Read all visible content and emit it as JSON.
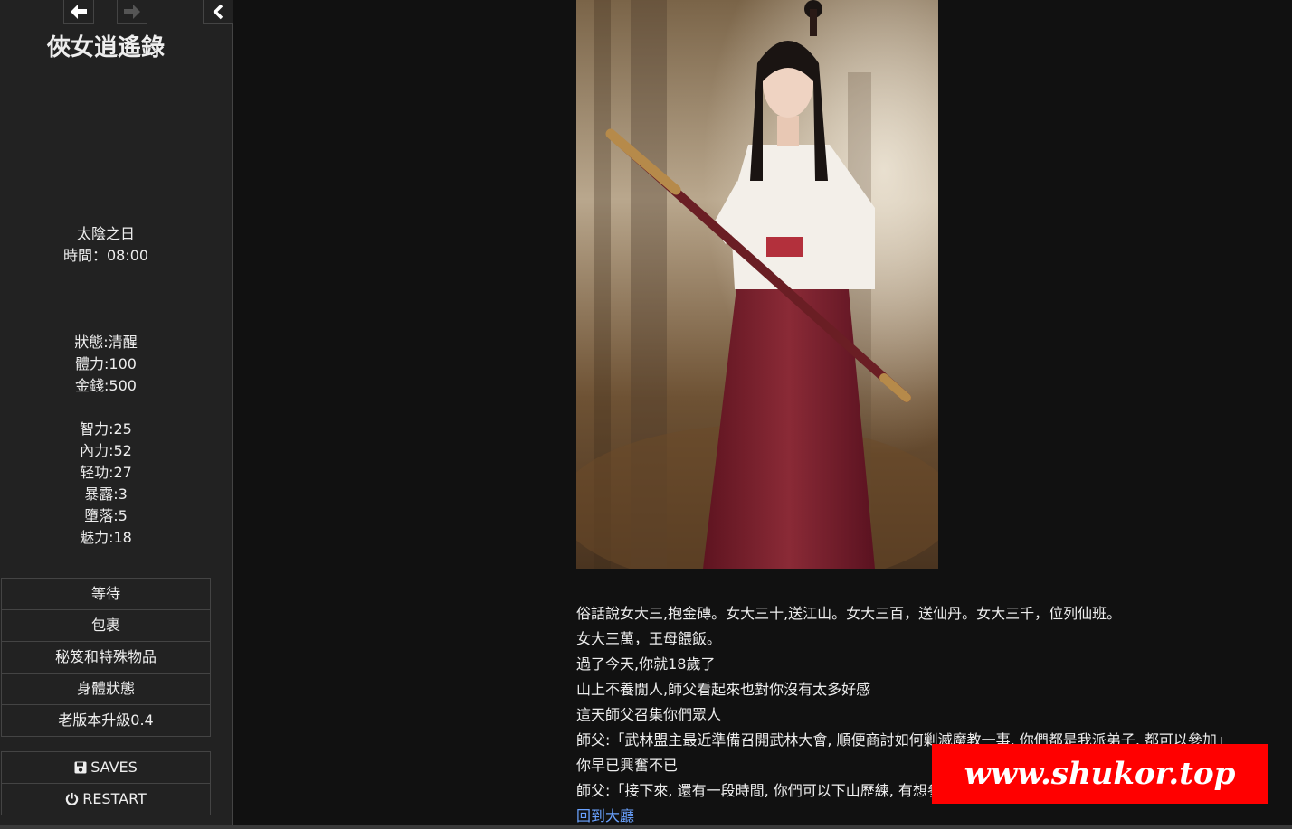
{
  "sidebar": {
    "title": "俠女逍遙錄",
    "day": "太陰之日",
    "time": "時間：08:00",
    "status": "狀態:清醒",
    "stamina": "體力:100",
    "money": "金錢:500",
    "intelligence": "智力:25",
    "inner_power": "內力:52",
    "lightness": "轻功:27",
    "exposure": "暴露:3",
    "depravity": "墮落:5",
    "charm": "魅力:18",
    "menu": [
      "等待",
      "包裹",
      "秘笈和特殊物品",
      "身體狀態",
      "老版本升級0.4"
    ],
    "saves_label": "SAVES",
    "restart_label": "RESTART"
  },
  "passage": {
    "lines": [
      "俗話說女大三,抱金磚。女大三十,送江山。女大三百，送仙丹。女大三千，位列仙班。",
      "女大三萬，王母餵飯。",
      "過了今天,你就18歲了",
      "山上不養閒人,師父看起來也對你沒有太多好感",
      "這天師父召集你們眾人",
      "師父:「武林盟主最近準備召開武林大會, 順便商討如何剿滅魔教一事, 你們都是我派弟子, 都可以參加」",
      "你早已興奮不已",
      "師父:「接下來, 還有一段時間, 你們可以下山歷練, 有想參加的, 明日隨我出發」"
    ],
    "return_link": "回到大廳"
  },
  "watermark": "www.shukor.top",
  "colors": {
    "sidebar_bg": "#222222",
    "page_bg": "#111111",
    "link": "#6aa2ff",
    "watermark_bg": "#ff0000"
  },
  "icons": {
    "back": "arrow-left-icon",
    "forward": "arrow-right-icon",
    "toggle": "chevron-left-icon",
    "saves": "floppy-disk-icon",
    "restart": "power-icon"
  }
}
